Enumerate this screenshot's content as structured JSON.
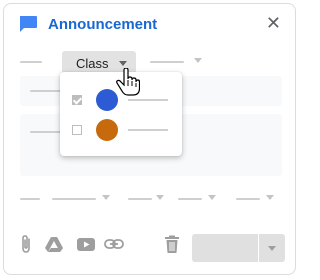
{
  "dialog": {
    "title": "Announcement",
    "close_glyph": "✕",
    "icon": "announcement-icon"
  },
  "audience": {
    "class_button_label": "Class",
    "options": [
      {
        "checked": true,
        "color": "#2d5bd3"
      },
      {
        "checked": false,
        "color": "#c66a0d"
      }
    ]
  },
  "toolbar": {
    "icons": [
      "attach-icon",
      "drive-icon",
      "youtube-icon",
      "link-icon"
    ],
    "delete_icon": "trash-icon"
  },
  "colors": {
    "accent": "#1967d2",
    "icon_gray": "#9e9e9e"
  }
}
